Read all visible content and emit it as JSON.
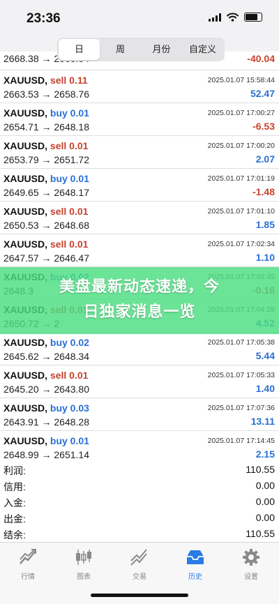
{
  "status_bar": {
    "time": "23:36"
  },
  "segments": [
    "日",
    "周",
    "月份",
    "自定义"
  ],
  "partial_top": {
    "line2": "2668.38 → 2663.34",
    "pnl": "-40.04"
  },
  "trades": [
    {
      "symbol": "XAUUSD",
      "side": "sell",
      "side_text": "sell 0.11",
      "prices": "2663.53 → 2658.76",
      "datetime": "2025.01.07 15:58:44",
      "pnl": "52.47",
      "pnl_sign": "pos"
    },
    {
      "symbol": "XAUUSD",
      "side": "buy",
      "side_text": "buy 0.01",
      "prices": "2654.71 → 2648.18",
      "datetime": "2025.01.07 17:00:27",
      "pnl": "-6.53",
      "pnl_sign": "neg"
    },
    {
      "symbol": "XAUUSD",
      "side": "sell",
      "side_text": "sell 0.01",
      "prices": "2653.79 → 2651.72",
      "datetime": "2025.01.07 17:00:20",
      "pnl": "2.07",
      "pnl_sign": "pos"
    },
    {
      "symbol": "XAUUSD",
      "side": "buy",
      "side_text": "buy 0.01",
      "prices": "2649.65 → 2648.17",
      "datetime": "2025.01.07 17:01:19",
      "pnl": "-1.48",
      "pnl_sign": "neg"
    },
    {
      "symbol": "XAUUSD",
      "side": "sell",
      "side_text": "sell 0.01",
      "prices": "2650.53 → 2648.68",
      "datetime": "2025.01.07 17:01:10",
      "pnl": "1.85",
      "pnl_sign": "pos"
    },
    {
      "symbol": "XAUUSD",
      "side": "sell",
      "side_text": "sell 0.01",
      "prices": "2647.57 → 2646.47",
      "datetime": "2025.01.07 17:02:34",
      "pnl": "1.10",
      "pnl_sign": "pos"
    },
    {
      "symbol": "XAUUSD",
      "side": "buy",
      "side_text": "buy 0.02",
      "prices": "2648.3",
      "datetime": "2025.01.07 17:02:45",
      "pnl": "-0.16",
      "pnl_sign": "neg"
    },
    {
      "symbol": "XAUUSD",
      "side": "sell",
      "side_text": "sell 0.01",
      "prices": "2650.72 → 2",
      "datetime": "2025.01.07 17:04:28",
      "pnl": "4.52",
      "pnl_sign": "pos"
    },
    {
      "symbol": "XAUUSD",
      "side": "buy",
      "side_text": "buy 0.02",
      "prices": "2645.62 → 2648.34",
      "datetime": "2025.01.07 17:05:38",
      "pnl": "5.44",
      "pnl_sign": "pos"
    },
    {
      "symbol": "XAUUSD",
      "side": "sell",
      "side_text": "sell 0.01",
      "prices": "2645.20 → 2643.80",
      "datetime": "2025.01.07 17:05:33",
      "pnl": "1.40",
      "pnl_sign": "pos"
    },
    {
      "symbol": "XAUUSD",
      "side": "buy",
      "side_text": "buy 0.03",
      "prices": "2643.91 → 2648.28",
      "datetime": "2025.01.07 17:07:36",
      "pnl": "13.11",
      "pnl_sign": "pos"
    },
    {
      "symbol": "XAUUSD",
      "side": "buy",
      "side_text": "buy 0.01",
      "prices": "2648.99 → 2651.14",
      "datetime": "2025.01.07 17:14:45",
      "pnl": "2.15",
      "pnl_sign": "pos"
    }
  ],
  "summary": [
    {
      "label": "利润:",
      "value": "110.55"
    },
    {
      "label": "信用:",
      "value": "0.00"
    },
    {
      "label": "入金:",
      "value": "0.00"
    },
    {
      "label": "出金:",
      "value": "0.00"
    },
    {
      "label": "结余:",
      "value": "110.55"
    }
  ],
  "banner": {
    "line1": "美盘最新动态速递，今",
    "line2": "日独家消息一览"
  },
  "tabs": [
    {
      "label": "行情",
      "icon": "quotes-icon"
    },
    {
      "label": "图表",
      "icon": "chart-icon"
    },
    {
      "label": "交易",
      "icon": "trade-icon"
    },
    {
      "label": "历史",
      "icon": "history-icon"
    },
    {
      "label": "设置",
      "icon": "settings-icon"
    }
  ],
  "colors": {
    "buy": "#2a6fd2",
    "sell": "#c8412c",
    "banner": "#4ade80",
    "active_tab": "#2a7be4"
  }
}
